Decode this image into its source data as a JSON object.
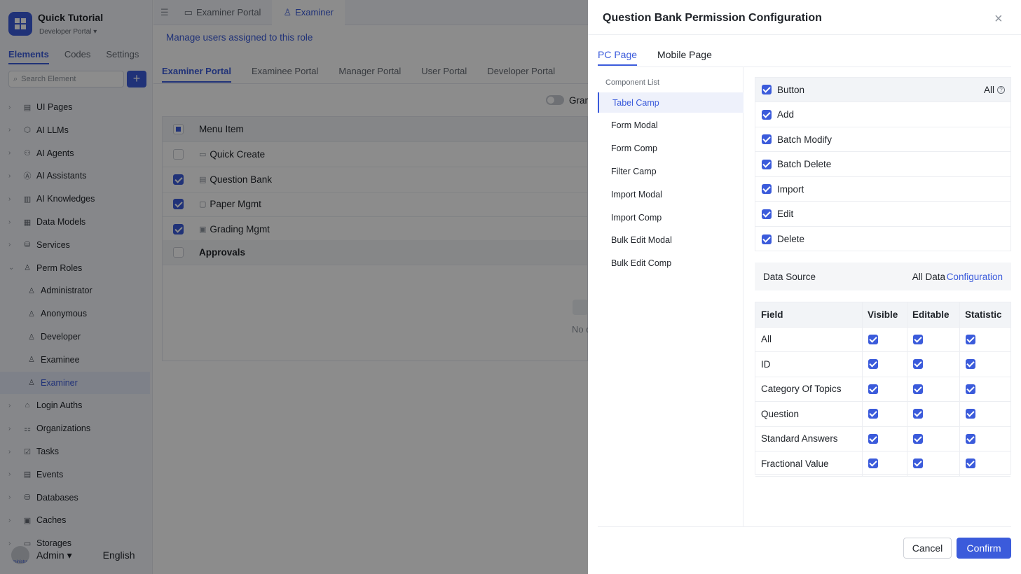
{
  "app": {
    "title": "Quick Tutorial",
    "subtitle": "Developer Portal ▾",
    "logo_icon": "windows-grid-icon"
  },
  "sidebar": {
    "tabs": [
      "Elements",
      "Codes",
      "Settings"
    ],
    "search_placeholder": "Search Element",
    "add_label": "+",
    "clipped_item": "User Portal",
    "items": [
      {
        "label": "UI Pages",
        "icon": "page-icon"
      },
      {
        "label": "AI LLMs",
        "icon": "llm-icon"
      },
      {
        "label": "AI Agents",
        "icon": "robot-icon"
      },
      {
        "label": "AI Assistants",
        "icon": "ai-icon"
      },
      {
        "label": "AI Knowledges",
        "icon": "book-icon"
      },
      {
        "label": "Data Models",
        "icon": "table-icon"
      },
      {
        "label": "Services",
        "icon": "service-icon"
      },
      {
        "label": "Perm Roles",
        "icon": "user-group-icon"
      },
      {
        "label": "Administrator",
        "icon": "user-icon"
      },
      {
        "label": "Anonymous",
        "icon": "user-icon"
      },
      {
        "label": "Developer",
        "icon": "user-icon"
      },
      {
        "label": "Examinee",
        "icon": "user-icon"
      },
      {
        "label": "Examiner",
        "icon": "user-icon"
      },
      {
        "label": "Login Auths",
        "icon": "bank-icon"
      },
      {
        "label": "Organizations",
        "icon": "org-icon"
      },
      {
        "label": "Tasks",
        "icon": "task-icon"
      },
      {
        "label": "Events",
        "icon": "event-icon"
      },
      {
        "label": "Databases",
        "icon": "database-icon"
      },
      {
        "label": "Caches",
        "icon": "cache-icon"
      },
      {
        "label": "Storages",
        "icon": "folder-icon"
      }
    ],
    "user": {
      "name": "Admin ▾",
      "avatar_text": "Administrator",
      "language": "English"
    }
  },
  "topbar": {
    "tabs": [
      "Examiner Portal",
      "Examiner"
    ]
  },
  "main": {
    "manage_link": "Manage users assigned to this role",
    "portal_tabs": [
      "Examiner Portal",
      "Examinee Portal",
      "Manager Portal",
      "User Portal",
      "Developer Portal"
    ],
    "grant_label": "Gran",
    "table_header": "Menu Item",
    "rows": [
      {
        "label": "Quick Create",
        "checked": false
      },
      {
        "label": "Question Bank",
        "checked": true
      },
      {
        "label": "Paper Mgmt",
        "checked": true
      },
      {
        "label": "Grading Mgmt",
        "checked": true
      }
    ],
    "group_row": "Approvals",
    "no_data": "No d"
  },
  "drawer": {
    "title": "Question Bank Permission Configuration",
    "close": "×",
    "tabs": [
      "PC Page",
      "Mobile Page"
    ],
    "component_list_title": "Component List",
    "components": [
      "Tabel Camp",
      "Form Modal",
      "Form Comp",
      "Filter Camp",
      "Import Modal",
      "Import Comp",
      "Bulk Edit Modal",
      "Bulk Edit Comp"
    ],
    "button_header": "Button",
    "all_label": "All",
    "help": "?",
    "buttons": [
      "Add",
      "Batch Modify",
      "Batch Delete",
      "Import",
      "Edit",
      "Delete"
    ],
    "data_source": {
      "label": "Data Source",
      "value": "All Data",
      "link": "Configuration"
    },
    "field_headers": [
      "Field",
      "Visible",
      "Editable",
      "Statistic"
    ],
    "fields": [
      "All",
      "ID",
      "Category Of Topics",
      "Question",
      "Standard Answers",
      "Fractional Value"
    ],
    "cancel": "Cancel",
    "confirm": "Confirm"
  },
  "colors": {
    "accent": "#3b5bdb",
    "overlay": "rgba(0,0,0,0.45)"
  }
}
